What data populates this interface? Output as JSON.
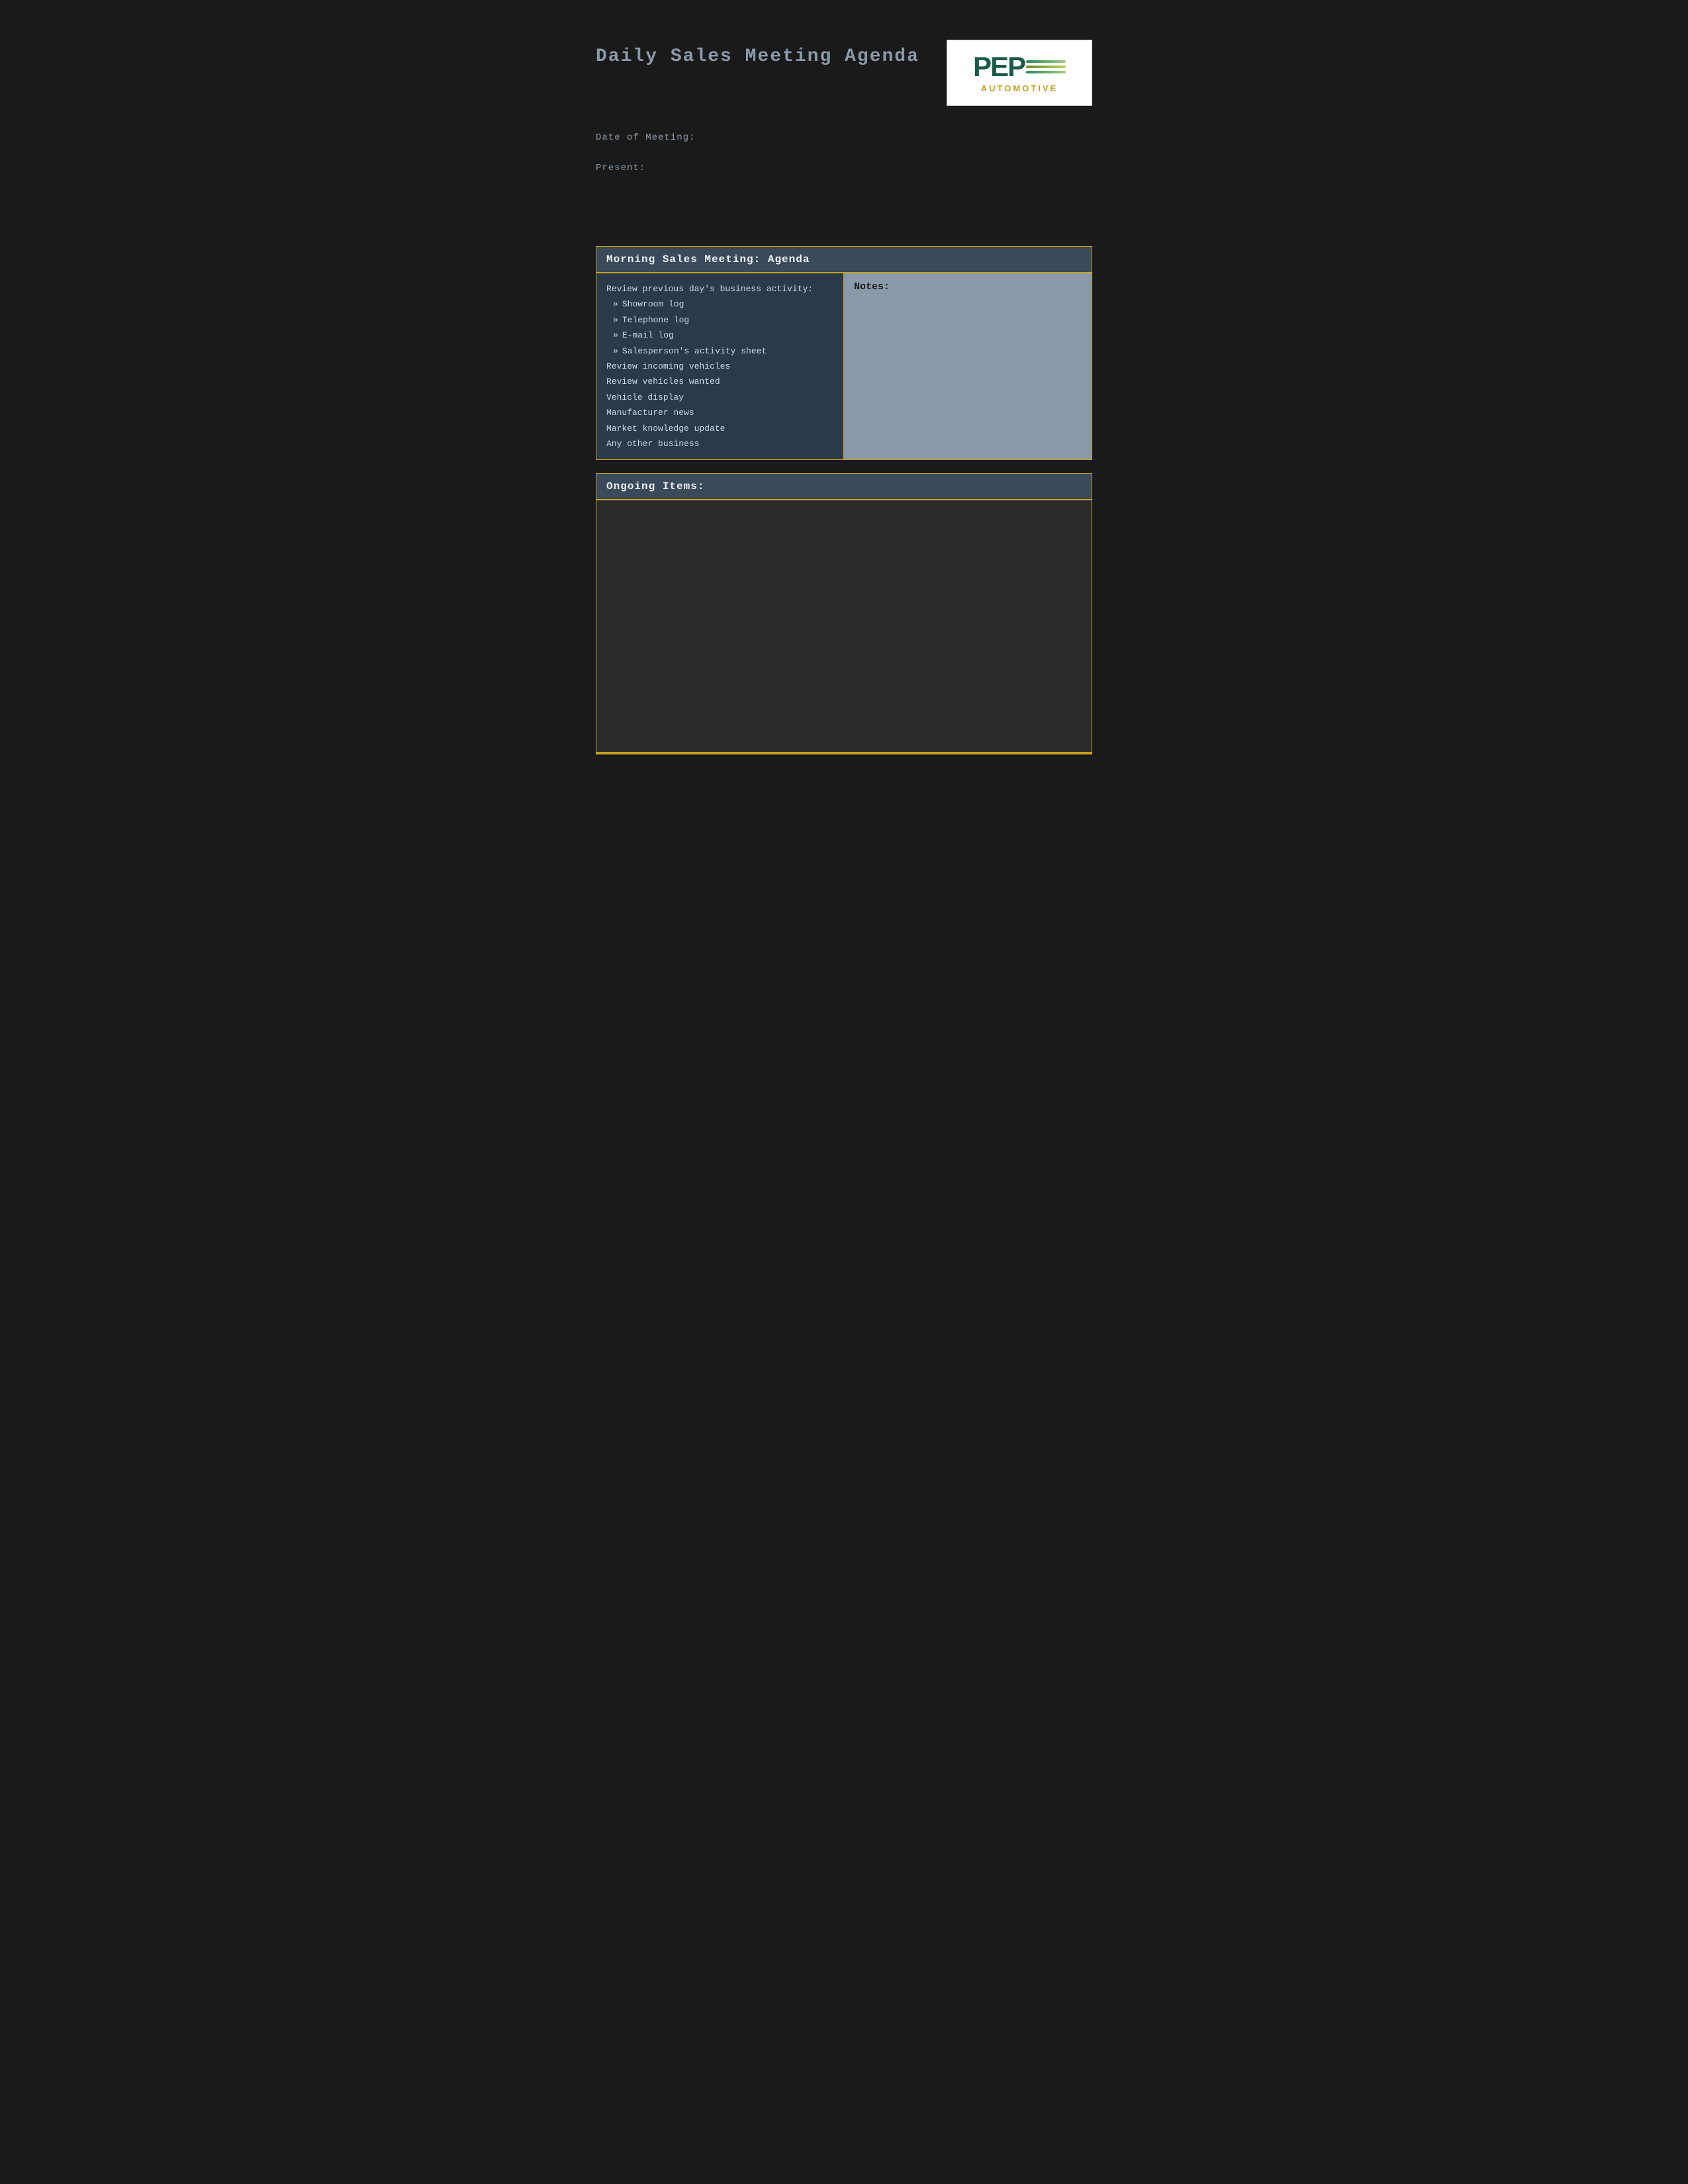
{
  "page": {
    "title": "Daily Sales Meeting Agenda",
    "background": "#1a1a1a"
  },
  "logo": {
    "text": "PEP",
    "automotive": "AUTOMOTIVE"
  },
  "meta": {
    "date_label": "Date of Meeting:",
    "present_label": "Present:"
  },
  "morning_section": {
    "header": "Morning Sales Meeting: Agenda",
    "left_items": [
      {
        "type": "heading",
        "text": "Review previous day's business activity:"
      },
      {
        "type": "bullet",
        "text": "Showroom log"
      },
      {
        "type": "bullet",
        "text": "Telephone log"
      },
      {
        "type": "bullet",
        "text": "E-mail log"
      },
      {
        "type": "bullet",
        "text": "Salesperson's activity sheet"
      },
      {
        "type": "plain",
        "text": "Review incoming vehicles"
      },
      {
        "type": "plain",
        "text": "Review vehicles wanted"
      },
      {
        "type": "plain",
        "text": "Vehicle display"
      },
      {
        "type": "plain",
        "text": "Manufacturer news"
      },
      {
        "type": "plain",
        "text": "Market knowledge update"
      },
      {
        "type": "plain",
        "text": "Any other business"
      }
    ],
    "right_label": "Notes:"
  },
  "ongoing_section": {
    "header": "Ongoing Items:"
  }
}
